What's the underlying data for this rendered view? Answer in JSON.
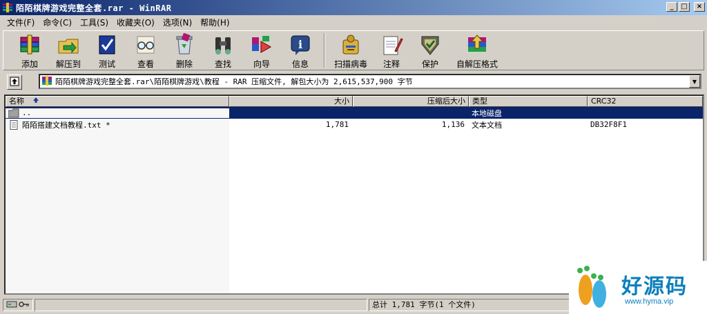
{
  "window": {
    "title": "陌陌棋牌游戏完整全套.rar - WinRAR",
    "controls": [
      "minimize",
      "maximize",
      "close"
    ]
  },
  "menu": [
    {
      "label": "文件(F)"
    },
    {
      "label": "命令(C)"
    },
    {
      "label": "工具(S)"
    },
    {
      "label": "收藏夹(O)"
    },
    {
      "label": "选项(N)"
    },
    {
      "label": "帮助(H)"
    }
  ],
  "toolbar": [
    {
      "label": "添加",
      "icon": "add-books-icon"
    },
    {
      "label": "解压到",
      "icon": "extract-folder-icon"
    },
    {
      "label": "测试",
      "icon": "test-check-icon"
    },
    {
      "label": "查看",
      "icon": "view-glasses-icon"
    },
    {
      "label": "删除",
      "icon": "delete-recycle-icon"
    },
    {
      "label": "查找",
      "icon": "find-binoculars-icon"
    },
    {
      "label": "向导",
      "icon": "wizard-icon"
    },
    {
      "label": "信息",
      "icon": "info-icon"
    },
    {
      "label": "扫描病毒",
      "icon": "virus-scan-icon"
    },
    {
      "label": "注释",
      "icon": "comment-notepad-icon"
    },
    {
      "label": "保护",
      "icon": "protect-shield-icon"
    },
    {
      "label": "自解压格式",
      "icon": "sfx-icon"
    }
  ],
  "address": {
    "path": "陌陌棋牌游戏完整全套.rar\\陌陌棋牌游戏\\教程 - RAR 压缩文件, 解包大小为 2,615,537,900 字节"
  },
  "columns": {
    "name": "名称",
    "size": "大小",
    "packed": "压缩后大小",
    "type": "类型",
    "crc": "CRC32"
  },
  "rows": [
    {
      "name": "..",
      "size": "",
      "packed": "",
      "type": "本地磁盘",
      "crc": "",
      "kind": "folder",
      "selected": true
    },
    {
      "name": "陌陌搭建文档教程.txt *",
      "size": "1,781",
      "packed": "1,136",
      "type": "文本文档",
      "crc": "DB32F8F1",
      "kind": "text",
      "selected": false
    }
  ],
  "status": {
    "summary": "总计 1,781 字节(1 个文件)"
  },
  "watermark": {
    "title": "好源码",
    "url": "www.hyma.vip"
  },
  "colors": {
    "title_gradient_start": "#0a246a",
    "title_gradient_end": "#a6caf0",
    "selection": "#0a246a",
    "face": "#d4d0c8",
    "watermark": "#0d7fbd"
  }
}
